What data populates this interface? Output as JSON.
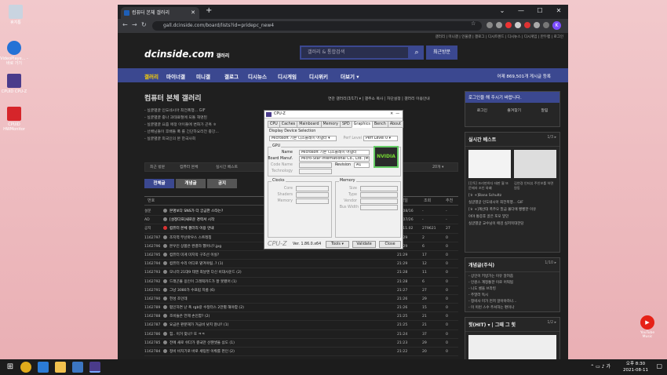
{
  "desktop": {
    "icons": [
      {
        "label": "휴지통",
        "color": "#c9d4e0"
      },
      {
        "label": "VideoPlaye... - 바로 가기",
        "color": "#2472d6"
      },
      {
        "label": "CPUID CPU-Z",
        "color": "#4a3b8b"
      },
      {
        "label": "CPUID HWMonitor",
        "color": "#d6252a"
      }
    ],
    "youtube_label": "YouTube Music"
  },
  "browser": {
    "tab_title": "컴퓨터 본체 갤러리",
    "url": "gall.dcinside.com/board/lists?id=pridepc_new4",
    "avatar": "K"
  },
  "site": {
    "top_links": "갤러리 | 미니갤 | 인물갤 | 갤로그 | 디시트렌드 | 디시뉴스 | 디시게임 | 만두랩 | 로그인",
    "logo": "dcinside.com",
    "logo_sub": "갤러리",
    "search_placeholder": "갤러리 & 통합검색",
    "recent": "최근방문",
    "gnb": [
      "갤러리",
      "마이너갤",
      "미니갤",
      "갤로그",
      "디시뉴스",
      "디시게임",
      "디시위키",
      "더보기 ▾"
    ],
    "gnb_stats": "어제 869,501개 게시글 등록",
    "gallery_title": "컴퓨터 본체 갤러리",
    "gallery_menu": "연관 갤러리(3/17) ▾ | 갤주소 복사 | 차단설정 | 갤러리 이용안내",
    "notices": [
      "- 실글별글 인도네시아 최전폭행... GIF",
      "- 실글별글 중나 과태료절에 되돌 해명된",
      "- 실글별글 요즘 애정 아이들에 변화가 곤혹 ㅎ",
      "- 선배님들이 후배들 폭 를 긴단하요리전 중강...",
      "- 실글별글 외국인의 본 한국사회"
    ],
    "filter": [
      "최근 방문",
      "컴퓨터 본체",
      "실시간 베스트"
    ],
    "filter_right": "20개 ▾",
    "btns": [
      "전체글",
      "개념글",
      "공지"
    ],
    "thead": {
      "no": "번호",
      "title": "제목",
      "date": "작성일",
      "views": "조회",
      "rec": "추천"
    },
    "rows": [
      {
        "no": "설문",
        "title": "본명보다 SNS가 더 궁금한 스타는?",
        "date": "21/08/16",
        "views": "-",
        "rec": "-"
      },
      {
        "no": "AD",
        "title": "[설정다프]새로운 경력서 시작",
        "date": "21/07/26",
        "views": "-",
        "rec": "-"
      },
      {
        "no": "공지",
        "title": "컴퓨터 본체 갤러리 이용 안내",
        "date": "20.11.02",
        "views": "279621",
        "rec": "27"
      },
      {
        "no": "1162797",
        "title": "조지역 부산마우스 스트레칭",
        "date": "21:29",
        "views": "2",
        "rec": "0"
      },
      {
        "no": "1162796",
        "title": "본우인 상품은 완결하 했어나?.jpg",
        "date": "21:29",
        "views": "6",
        "rec": "0"
      },
      {
        "no": "1162795",
        "title": "컴퓨터 미게 미지막 구조선 이실?",
        "date": "21:29",
        "views": "17",
        "rec": "0"
      },
      {
        "no": "1162794",
        "title": "컴퓨터 수리 어디로 맡겨야됨..? (1)",
        "date": "21:29",
        "views": "12",
        "rec": "0"
      },
      {
        "no": "1162793",
        "title": "모니터 21대9 테엔 최날엔 다신 비대사운드 (2)",
        "date": "21:28",
        "views": "11",
        "rec": "0"
      },
      {
        "no": "1162792",
        "title": "드래곤볼 옹인이 그래픽카드가 잘 못됐어 (1)",
        "date": "21:28",
        "views": "6",
        "rec": "0"
      },
      {
        "no": "1162791",
        "title": "그냥 3080가 수프립 지름 (6)",
        "date": "21:27",
        "views": "27",
        "rec": "0"
      },
      {
        "no": "1162790",
        "title": "헌성 조인데",
        "date": "21:26",
        "views": "29",
        "rec": "0"
      },
      {
        "no": "1162789",
        "title": "펌인하면 난 폭 rgb랑 수정터스 2만별 해야함 (2)",
        "date": "21:26",
        "views": "15",
        "rec": "0"
      },
      {
        "no": "1162788",
        "title": "조비들은 언제 손인함? (2)",
        "date": "21:25",
        "views": "21",
        "rec": "0"
      },
      {
        "no": "1162787",
        "title": "요금은 판분해가 거금비 낮지 않냐? (1)",
        "date": "21:25",
        "views": "21",
        "rec": "0"
      },
      {
        "no": "1162786",
        "title": "힘.. 이거 맞나? 또 ㅋㅋ",
        "date": "21:24",
        "views": "37",
        "rec": "0"
      },
      {
        "no": "1162785",
        "title": "전에 새로 쉬다가 결국만 산잰셋을 샀도 (1)",
        "date": "21:23",
        "views": "29",
        "rec": "0"
      },
      {
        "no": "1162784",
        "title": "정비 비치기로 바로 세팅된 이뤄를 펀인 (2)",
        "date": "21:22",
        "views": "20",
        "rec": "0"
      }
    ],
    "side": {
      "login_msg": "로그인을 해 주시기 바랍니다.",
      "login_btns": [
        "로그인",
        "즐겨찾기",
        "알림"
      ],
      "best_title": "실시간 베스트",
      "best_num": "1/3 ▸",
      "best_caps": [
        "[단독] 조리판하다 태판 뭘 또 문제자 조인 와떄",
        "김연경 인터뷰 주인보를 하면 원동"
      ],
      "best_list": [
        "[ㅎ +]Bana Schultz",
        "실글별글 인도네시아 최전폭행... GIF",
        "[ㅎ +]계산대 폭주오 밑금 몰다에 빵빵한 이유",
        "야야 통증후 골은 포모 밑던",
        "실글별글 교수님이 애검 실저목대한당"
      ],
      "concept_title": "개념글(주식)",
      "concept_num": "1/10 ▸",
      "concept_list": [
        "- 상인이 키방가는 이유 알려줌",
        "- 인원스 계정통한 이로 어떡됨",
        "- 니도 셀을 브라킹",
        "- 주말러 독시",
        "- 정비사 미가 먼저 알아야하나...",
        "- 이 이런 스수 주셔하는 편이나"
      ],
      "hit_title": "힛(HIT) ▾ | 그때 그 힛",
      "hit_num": "1/2 ▸"
    }
  },
  "cpuz": {
    "title": "CPU-Z",
    "tabs": [
      "CPU",
      "Caches",
      "Mainboard",
      "Memory",
      "SPD",
      "Graphics",
      "Bench",
      "About"
    ],
    "display_label": "Display Device Selection",
    "display_value": "Microsoft 기본 디스플레이 어댑터",
    "perf_label": "Perf Level",
    "perf_value": "Perf Level 0",
    "gpu_group": "GPU",
    "name_label": "Name",
    "name_value": "Microsoft 기본 디스플레이 어댑터",
    "board_label": "Board Manuf.",
    "board_value": "Micro-Star International Co., Ltd. (MSI)",
    "code_label": "Code Name",
    "revision_label": "Revision",
    "revision_value": "A1",
    "tech_label": "Technology",
    "clocks_group": "Clocks",
    "clock_labels": [
      "Core",
      "Shaders",
      "Memory"
    ],
    "memory_group": "Memory",
    "memory_labels": [
      "Size",
      "Type",
      "Vendor",
      "Bus Width"
    ],
    "brand": "CPU-Z",
    "version": "Ver. 1.86.0.x64",
    "tools": "Tools",
    "validate": "Validate",
    "close": "Close",
    "nvidia": "NVIDIA"
  },
  "taskbar": {
    "time": "오후 8:30",
    "date": "2021-08-11"
  }
}
